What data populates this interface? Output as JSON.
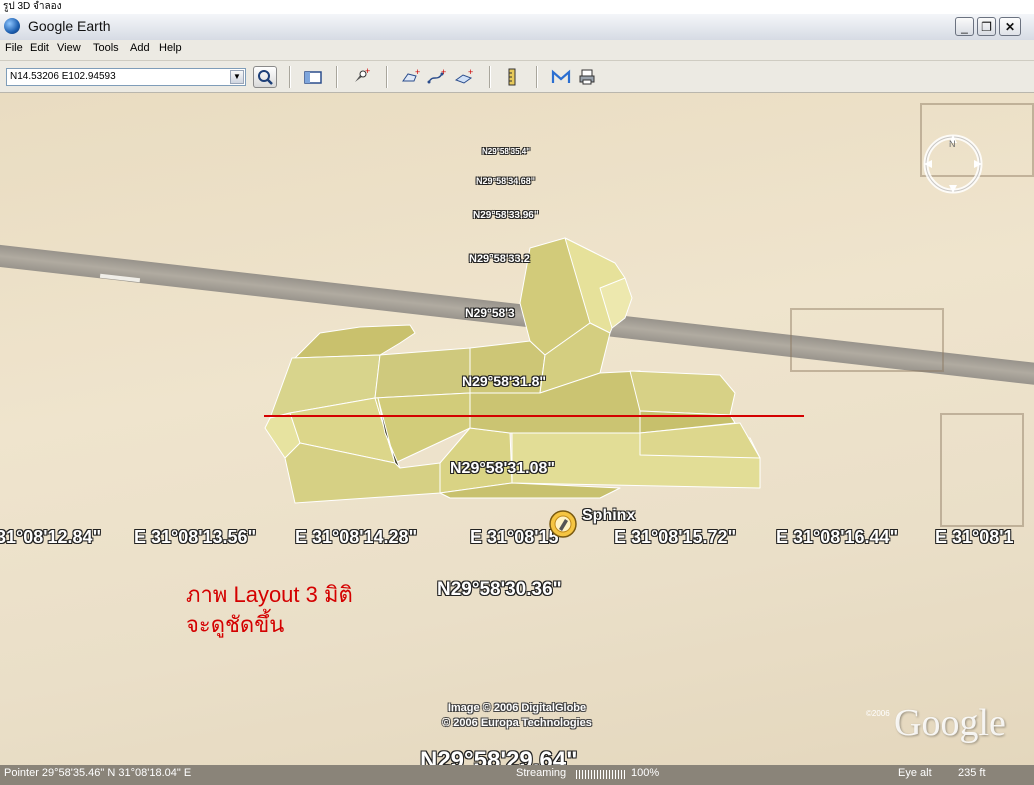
{
  "document_caption": "รูป 3D จำลอง",
  "window": {
    "title": "Google Earth",
    "minimize": "_",
    "restore": "❐",
    "close": "✕"
  },
  "menu": [
    "File",
    "Edit",
    "View",
    "Tools",
    "Add",
    "Help"
  ],
  "search": {
    "value": "N14.53206 E102.94593",
    "dropdown_icon": "chevron-down-icon",
    "go_icon": "search-icon"
  },
  "toolbar": {
    "icons": [
      "sidebar-toggle-icon",
      "add-placemark-icon",
      "add-polygon-icon",
      "add-path-icon",
      "add-image-overlay-icon",
      "ruler-icon",
      "email-icon",
      "print-icon"
    ]
  },
  "viewport": {
    "lat_labels": [
      "N29°58'35.4\"",
      "N29°58'34.68\"",
      "N29°58'33.96\"",
      "N29°58'33.2",
      "N29°58'3",
      "N29°58'31.8\"",
      "N29°58'31.08\"",
      "N29°58'30.36\"",
      "N29°58'29.64\""
    ],
    "lon_labels": [
      "31°08'12.84\"",
      "E 31°08'13.56\"",
      "E 31°08'14.28\"",
      "E 31°08'15\"",
      "E 31°08'15.72\"",
      "E 31°08'16.44\"",
      "E 31°08'1"
    ],
    "placemark": "Sphinx",
    "annotation_line1": "ภาพ Layout 3 มิติ",
    "annotation_line2": "จะดูชัดขึ้น",
    "credit_line1": "Image © 2006 DigitalGlobe",
    "credit_line2": "© 2006 Europa Technologies",
    "logo_year": "©2006",
    "logo": "Google",
    "compass_label": "N"
  },
  "status": {
    "pointer": "Pointer 29°58'35.46\"  N    31°08'18.04\"  E",
    "streaming": "Streaming",
    "streaming_pct": "100%",
    "eye_alt_label": "Eye alt",
    "eye_alt_value": "235 ft"
  },
  "colors": {
    "annotation": "#d40000",
    "model_face": "#d8d48c",
    "model_edge": "#ffffff"
  }
}
